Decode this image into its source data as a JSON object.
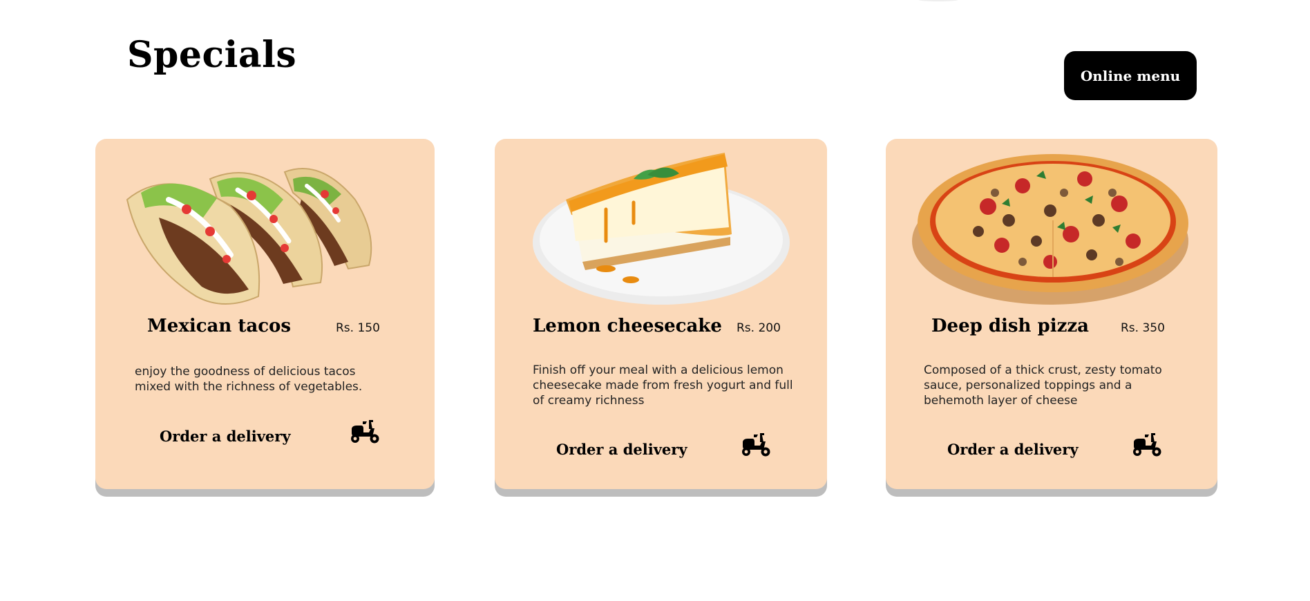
{
  "header": {
    "title": "Specials",
    "online_menu_label": "Online menu"
  },
  "specials": [
    {
      "name": "Mexican tacos",
      "price": "Rs. 150",
      "description": "enjoy the goodness of delicious tacos mixed with the richness of vegetables.",
      "order_label": "Order a delivery",
      "image": "tacos-image",
      "icon": "scooter-icon"
    },
    {
      "name": "Lemon cheesecake",
      "price": "Rs. 200",
      "description": "Finish off your meal with a delicious lemon cheesecake made from fresh yogurt and full of creamy richness",
      "order_label": "Order a delivery",
      "image": "cheesecake-image",
      "icon": "scooter-icon"
    },
    {
      "name": "Deep dish pizza",
      "price": "Rs. 350",
      "description": "Composed of a thick crust, zesty tomato sauce, personalized toppings and a behemoth layer of cheese",
      "order_label": "Order a delivery",
      "image": "pizza-image",
      "icon": "scooter-icon"
    }
  ],
  "colors": {
    "card_background": "#fbd9b9",
    "card_shadow": "#bdbdbd",
    "button_background": "#000000",
    "button_text": "#ffffff"
  }
}
